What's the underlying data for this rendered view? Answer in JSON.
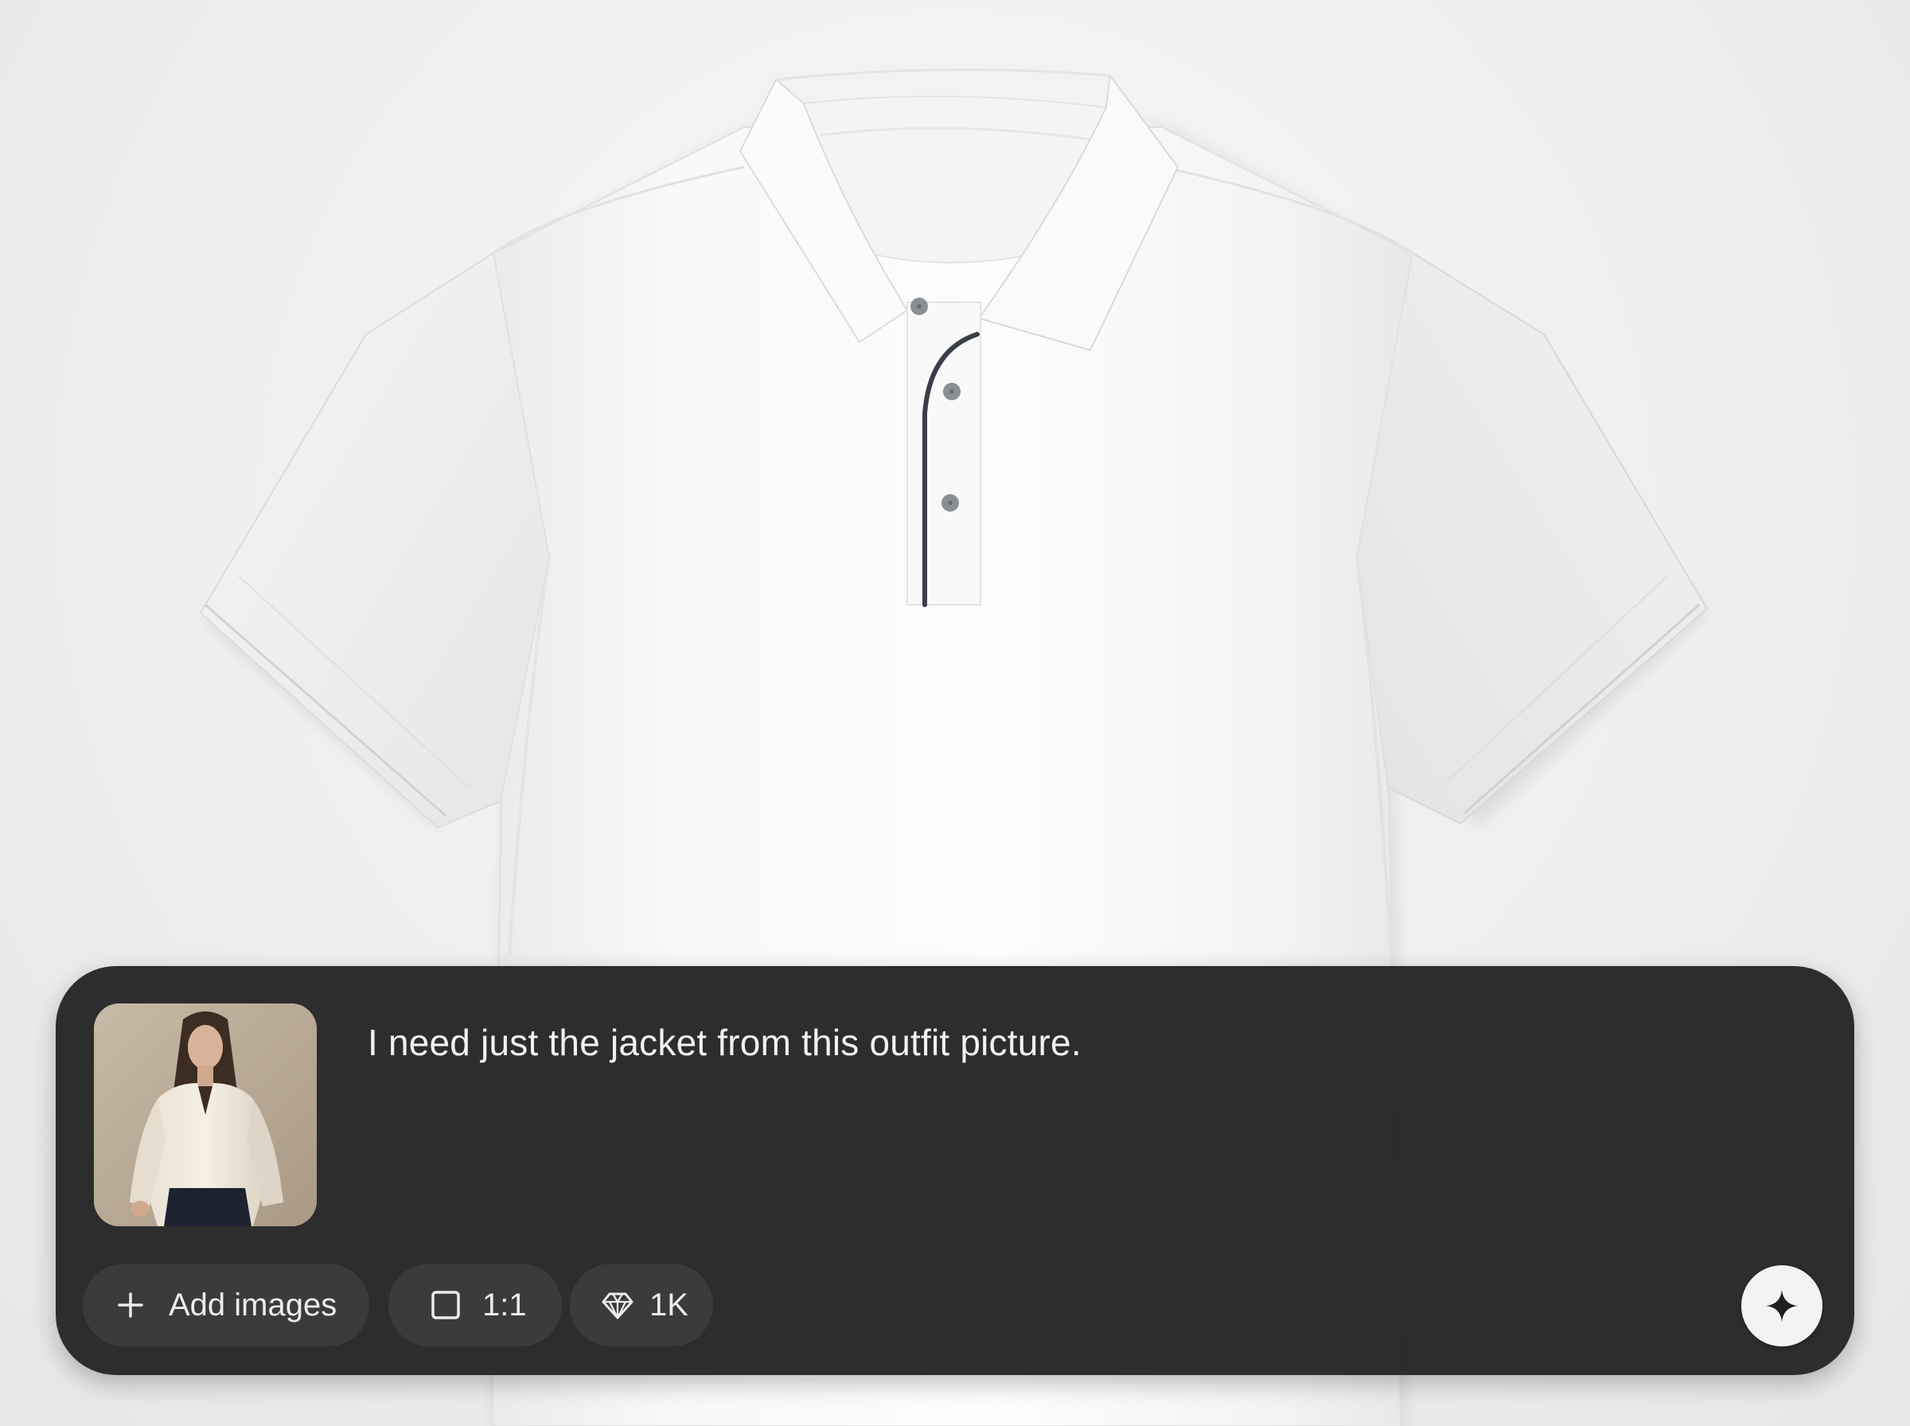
{
  "composer": {
    "prompt_text": "I need just the jacket from this outfit picture.",
    "attachment": {
      "description_icon": "outfit-photo-thumbnail"
    },
    "chips": {
      "add_images_label": "Add images",
      "aspect_ratio_label": "1:1",
      "quality_label": "1K"
    },
    "send_icon": "sparkle-icon"
  },
  "colors": {
    "panel_bg": "#262626",
    "text": "#f1f1f1",
    "send_button_bg": "#f2f2f2",
    "send_icon": "#1e1e1e"
  }
}
